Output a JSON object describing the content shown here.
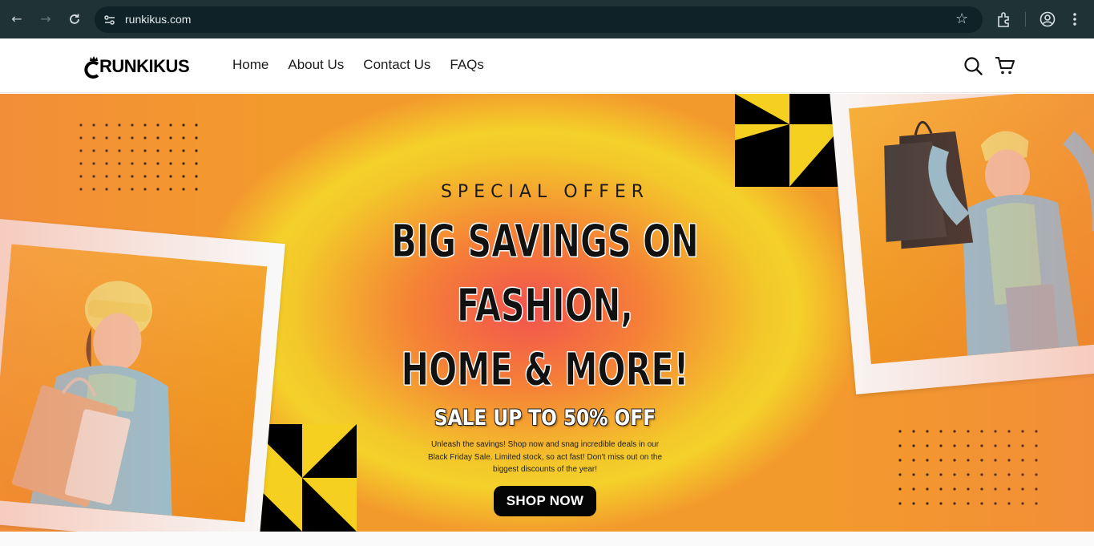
{
  "browser": {
    "url": "runkikus.com"
  },
  "site": {
    "logo_text": "RUNKIKUS",
    "nav": [
      "Home",
      "About Us",
      "Contact Us",
      "FAQs"
    ]
  },
  "hero": {
    "eyebrow": "SPECIAL OFFER",
    "headline_line1": "BIG SAVINGS ON FASHION,",
    "headline_line2": "HOME & MORE!",
    "sale": "SALE UP TO 50% OFF",
    "blurb": "Unleash the savings! Shop now and snag incredible deals in our Black Friday Sale. Limited stock, so act fast! Don't miss out on the biggest discounts of the year!",
    "cta": "SHOP NOW"
  },
  "colors": {
    "chrome_bg": "#1f3337",
    "urlbar_bg": "#0f2227",
    "hero_center": "#f2524f",
    "hero_edge": "#f4d12a",
    "accent_black": "#050505"
  }
}
